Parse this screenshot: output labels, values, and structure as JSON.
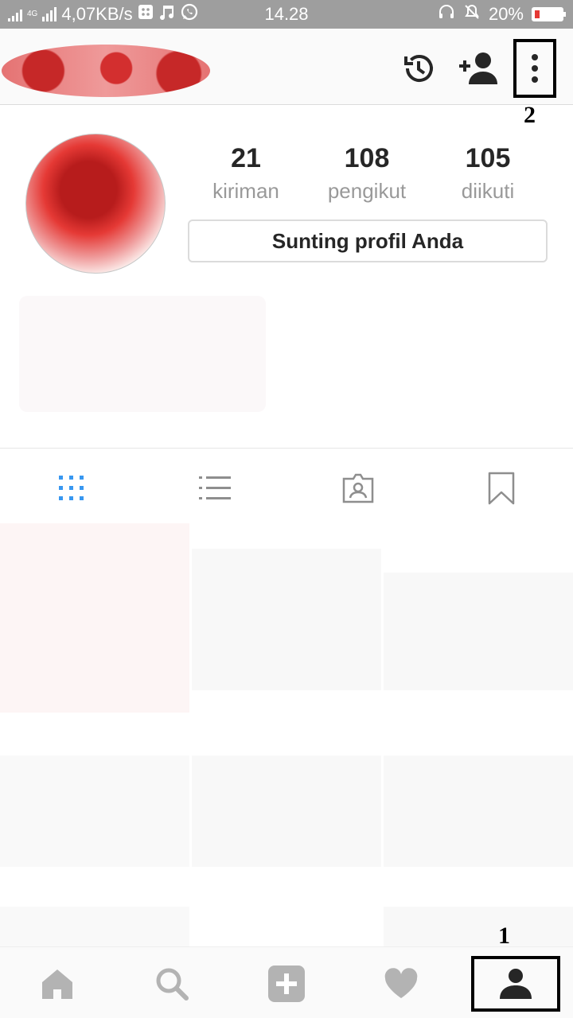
{
  "status_bar": {
    "network_type": "4G",
    "speed": "4,07KB/s",
    "time": "14.28",
    "battery_percent": "20%",
    "battery_level": 0.2,
    "icons": [
      "signal-icon",
      "bbm-icon",
      "music-icon",
      "whatsapp-icon",
      "headset-icon",
      "mute-icon",
      "battery-icon"
    ]
  },
  "header": {
    "icons": [
      "history-icon",
      "add-person-icon",
      "more-options-icon"
    ]
  },
  "profile": {
    "stats": [
      {
        "value": "21",
        "label": "kiriman"
      },
      {
        "value": "108",
        "label": "pengikut"
      },
      {
        "value": "105",
        "label": "diikuti"
      }
    ],
    "edit_button_label": "Sunting profil Anda"
  },
  "tabs": {
    "items": [
      "grid-icon",
      "list-icon",
      "tagged-icon",
      "saved-icon"
    ],
    "active_index": 0,
    "active_color": "#3897f0",
    "inactive_color": "#8e8e8e"
  },
  "bottom_nav": {
    "items": [
      "home-icon",
      "search-icon",
      "add-post-icon",
      "activity-heart-icon",
      "profile-icon"
    ],
    "active_index": 4
  },
  "annotations": {
    "label_1": "1",
    "label_2": "2"
  }
}
